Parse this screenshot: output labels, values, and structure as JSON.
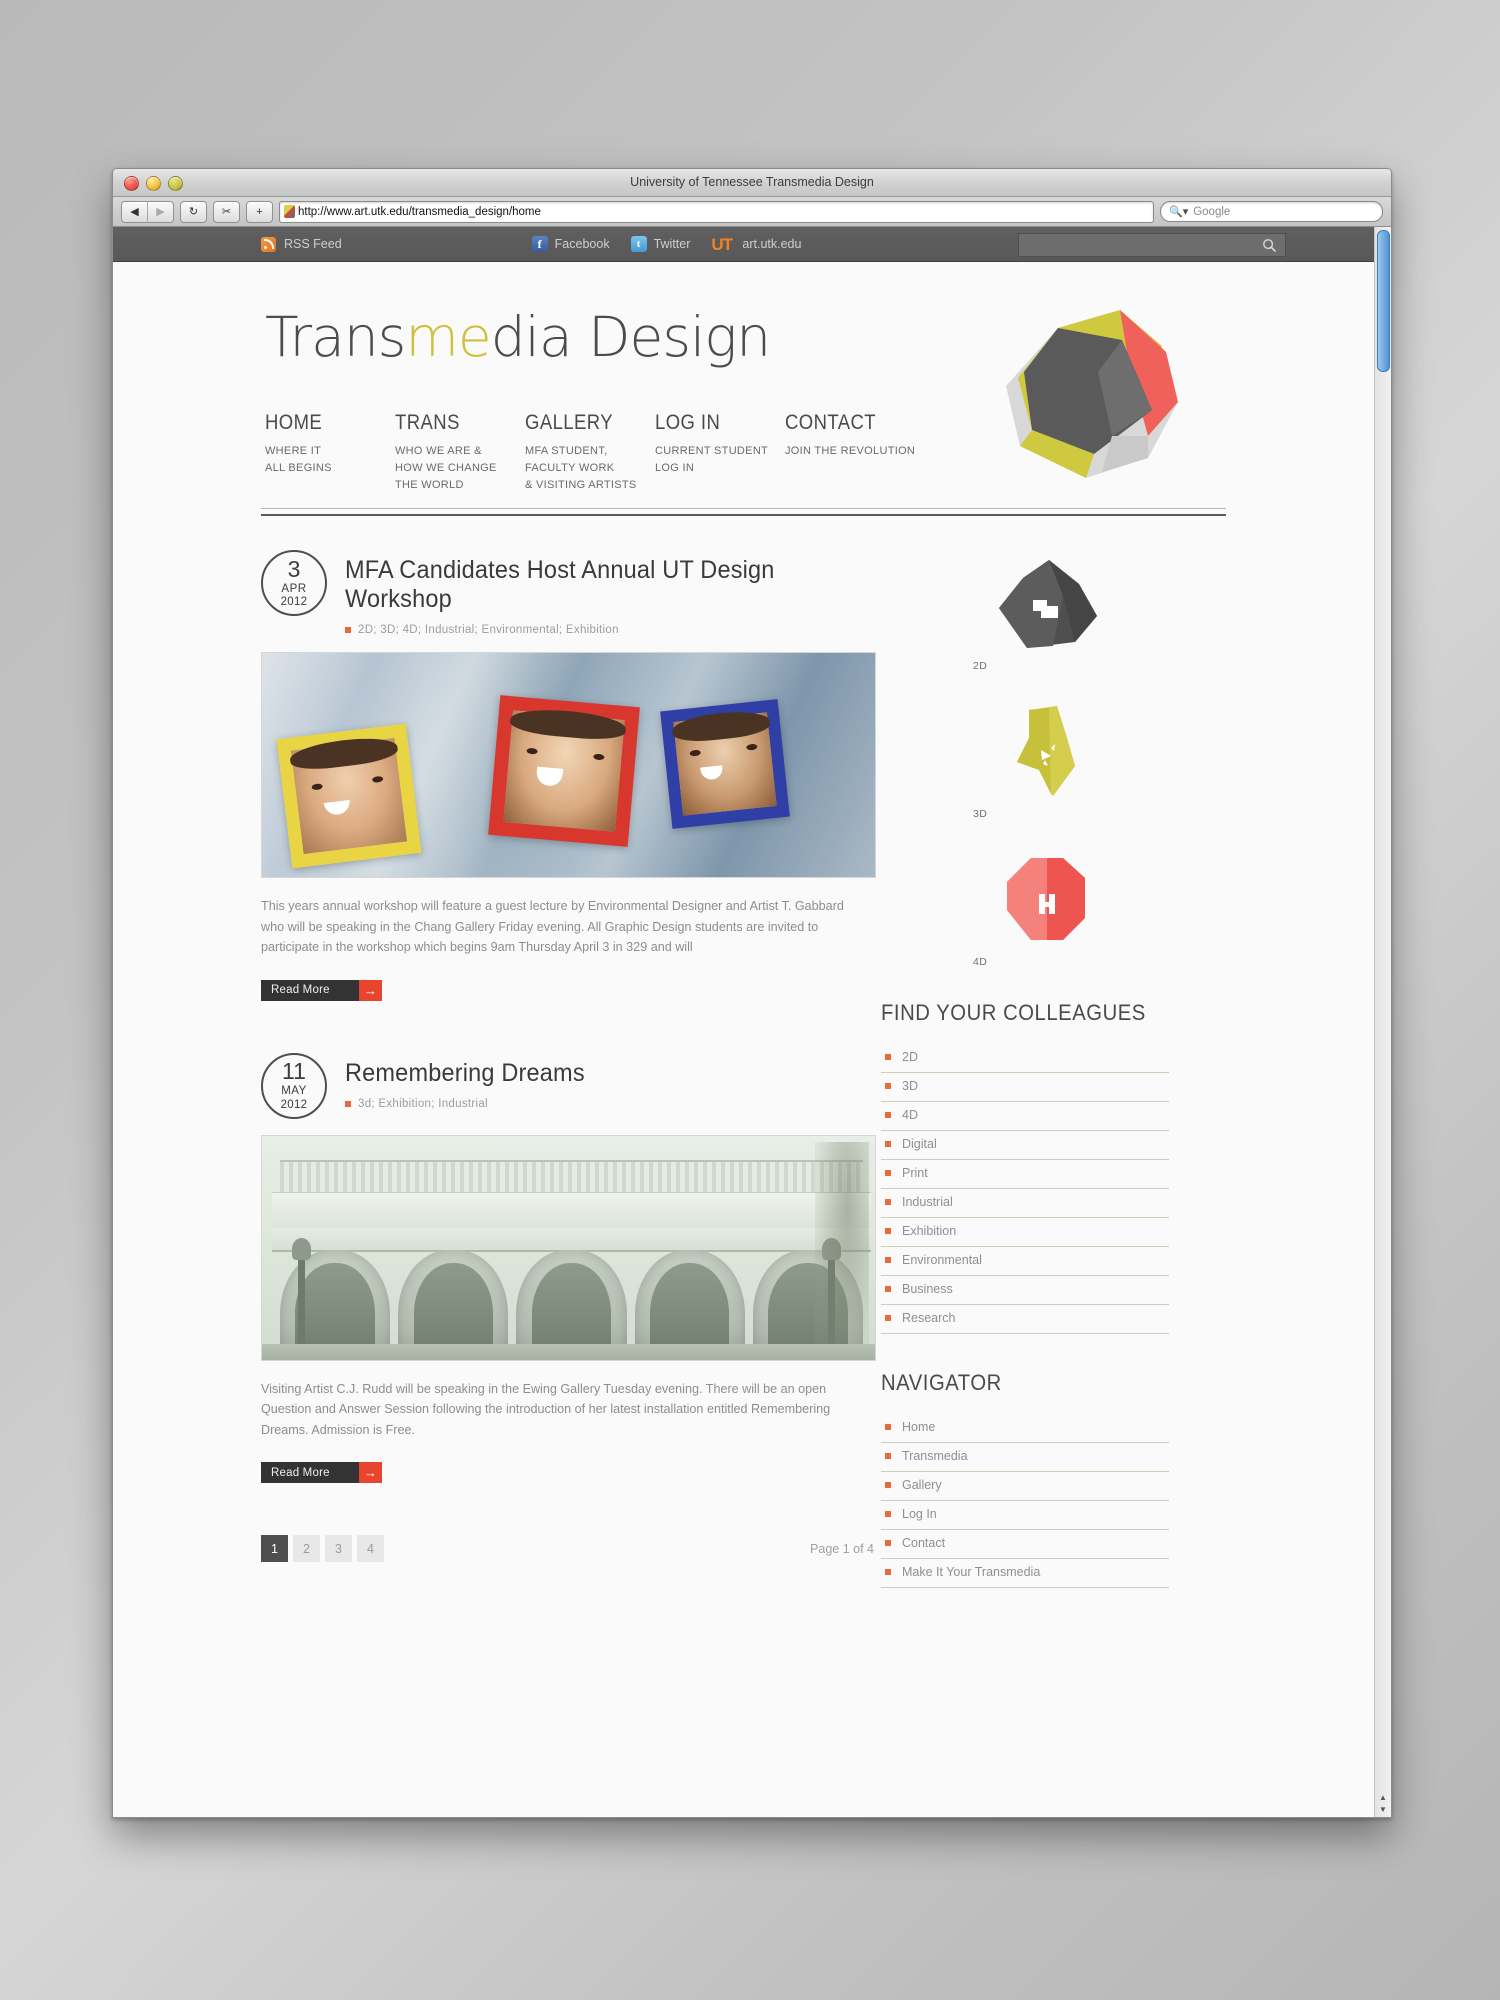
{
  "browser": {
    "window_title": "University of Tennessee Transmedia Design",
    "url": "http://www.art.utk.edu/transmedia_design/home",
    "search_placeholder": "Google",
    "back_icon": "back-arrow-icon",
    "forward_icon": "forward-arrow-icon",
    "reload_icon": "reload-icon",
    "snippet_icon": "snippet-icon",
    "add_icon": "plus-icon"
  },
  "utilbar": {
    "rss_label": "RSS Feed",
    "facebook_label": "Facebook",
    "twitter_label": "Twitter",
    "utk_label": "art.utk.edu",
    "utk_mark": "UT",
    "facebook_mark": "f",
    "twitter_mark": "t",
    "search_value": ""
  },
  "header": {
    "logo_part1": "Trans",
    "logo_highlight": "me",
    "logo_part2": "dia Design",
    "highlight_color": "#cfc13d"
  },
  "nav": [
    {
      "title": "HOME",
      "sub": "WHERE IT\nALL BEGINS"
    },
    {
      "title": "TRANS",
      "sub": "WHO WE ARE &\nHOW WE CHANGE\nTHE WORLD"
    },
    {
      "title": "GALLERY",
      "sub": "MFA STUDENT,\n FACULTY WORK\n& VISITING ARTISTS"
    },
    {
      "title": "LOG IN",
      "sub": "CURRENT STUDENT\nLOG IN"
    },
    {
      "title": "CONTACT",
      "sub": "JOIN THE REVOLUTION"
    }
  ],
  "articles": [
    {
      "day": "3",
      "month": "APR",
      "year": "2012",
      "title": "MFA Candidates Host Annual UT Design Workshop",
      "tags": "2D; 3D; 4D; Industrial; Environmental; Exhibition",
      "body": "This years annual workshop will feature a guest lecture by Environmental Designer and Artist T. Gabbard who will be speaking in the Chang Gallery Friday evening. All Graphic Design students are invited to participate in the workshop which begins 9am Thursday April 3 in 329 and will",
      "read_more": "Read More",
      "image_alt": "three students poking faces through colored picture frames wrapped in plastic"
    },
    {
      "day": "11",
      "month": "MAY",
      "year": "2012",
      "title": "Remembering Dreams",
      "tags": "3d; Exhibition; Industrial",
      "body": "Visiting Artist C.J. Rudd will be speaking in the Ewing Gallery Tuesday evening. There will be an open Question and Answer Session following the introduction of her latest installation entitled Remembering Dreams. Admission is Free.",
      "read_more": "Read More",
      "image_alt": "neoclassical building facade with arches and columns"
    }
  ],
  "pagination": {
    "pages": [
      "1",
      "2",
      "3",
      "4"
    ],
    "active_index": 0,
    "status": "Page 1 of 4"
  },
  "shapes": [
    {
      "label": "2D",
      "color": "#4f4f4f"
    },
    {
      "label": "3D",
      "color": "#cfc93f"
    },
    {
      "label": "4D",
      "color": "#f0615c"
    }
  ],
  "sidebar": {
    "colleagues_title": "FIND YOUR COLLEAGUES",
    "colleagues": [
      "2D",
      "3D",
      "4D",
      "Digital",
      "Print",
      "Industrial",
      "Exhibition",
      "Environmental",
      "Business",
      "Research"
    ],
    "navigator_title": "NAVIGATOR",
    "navigator": [
      "Home",
      "Transmedia",
      "Gallery",
      "Log In",
      "Contact",
      "Make It Your Transmedia"
    ]
  }
}
